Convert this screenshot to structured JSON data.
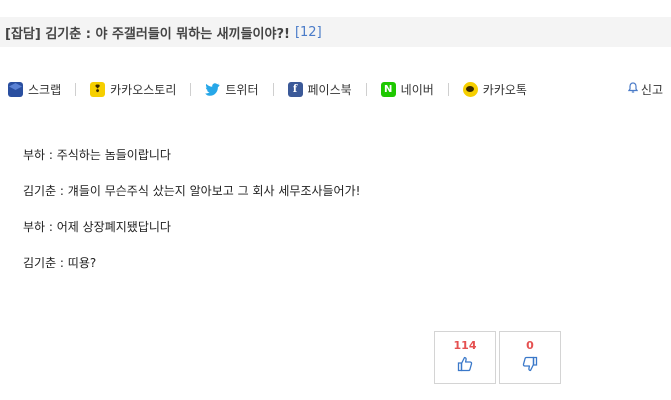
{
  "post": {
    "title": "[잡담] 김기춘 : 야 주갤러들이 뭐하는 새끼들이야?!",
    "comment_count": "[12]"
  },
  "share": {
    "items": [
      {
        "label": "스크랩",
        "icon": "scrap-icon"
      },
      {
        "label": "카카오스토리",
        "icon": "kakaostory-icon"
      },
      {
        "label": "트위터",
        "icon": "twitter-icon"
      },
      {
        "label": "페이스북",
        "icon": "facebook-icon"
      },
      {
        "label": "네이버",
        "icon": "naver-icon"
      },
      {
        "label": "카카오톡",
        "icon": "kakaotalk-icon"
      }
    ],
    "report_label": "신고"
  },
  "content": {
    "lines": [
      "부하 : 주식하는 놈들이랍니다",
      "김기춘 : 걔들이 무슨주식 샀는지 알아보고 그 회사 세무조사들어가!",
      "부하 : 어제 상장폐지됐답니다",
      "김기춘 : 띠용?"
    ]
  },
  "votes": {
    "up_count": "114",
    "down_count": "0"
  },
  "colors": {
    "accent_blue": "#4a7bc8",
    "vote_red": "#e55050"
  }
}
